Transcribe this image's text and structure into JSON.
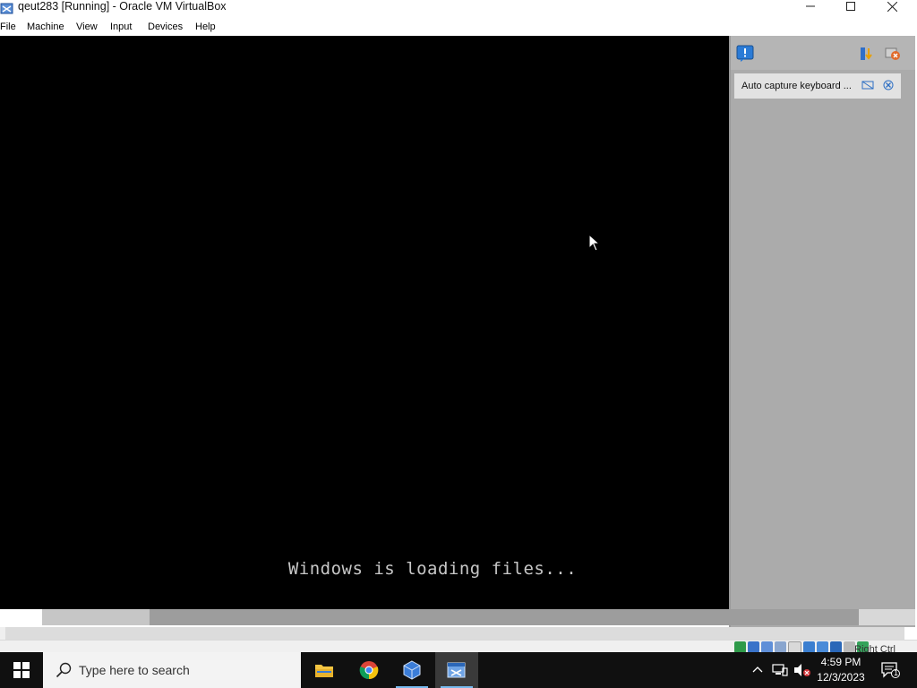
{
  "window": {
    "title": "qeut283 [Running] - Oracle VM VirtualBox",
    "controls": {
      "minimize": "minimize",
      "maximize": "maximize",
      "close": "close"
    }
  },
  "menu": [
    {
      "label": "File"
    },
    {
      "label": "Machine"
    },
    {
      "label": "View"
    },
    {
      "label": "Input"
    },
    {
      "label": "Devices"
    },
    {
      "label": "Help"
    }
  ],
  "guest": {
    "message": "Windows is loading files..."
  },
  "notification_panel": {
    "item": "Auto capture keyboard ..."
  },
  "statusbar": {
    "host_key": "Right Ctrl"
  },
  "taskbar": {
    "search_placeholder": "Type here to search",
    "clock_time": "4:59 PM",
    "clock_date": "12/3/2023",
    "notification_count": "1"
  },
  "colors": {
    "guest_background": "#000000",
    "taskbar": "#101010",
    "active_app_underline": "#76b9ed"
  }
}
